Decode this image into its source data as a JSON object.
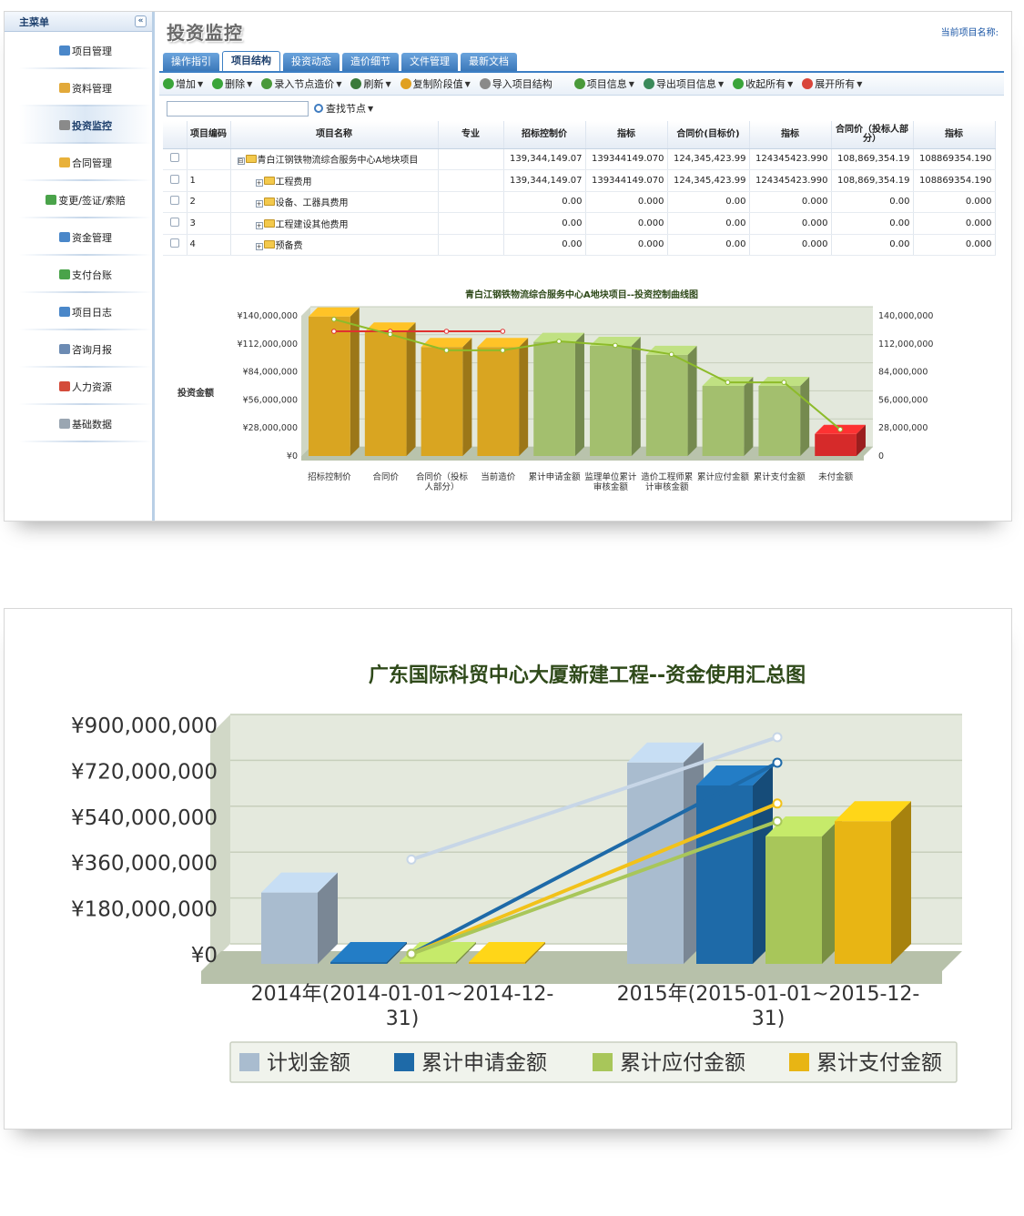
{
  "sidebar": {
    "header": "主菜单",
    "collapse": "«",
    "items": [
      {
        "label": "项目管理",
        "color": "#4a87c9"
      },
      {
        "label": "资料管理",
        "color": "#e2a93a"
      },
      {
        "label": "投资监控",
        "color": "#8a8a8a"
      },
      {
        "label": "合同管理",
        "color": "#e8b13a"
      },
      {
        "label": "变更/签证/索赔",
        "color": "#4aa34a"
      },
      {
        "label": "资金管理",
        "color": "#4a87c9"
      },
      {
        "label": "支付台账",
        "color": "#4aa34a"
      },
      {
        "label": "项目日志",
        "color": "#4a87c9"
      },
      {
        "label": "咨询月报",
        "color": "#6c8bb3"
      },
      {
        "label": "人力资源",
        "color": "#d44b3a"
      },
      {
        "label": "基础数据",
        "color": "#9aa6b2"
      }
    ]
  },
  "main": {
    "title": "投资监控",
    "project_name_label": "当前项目名称:",
    "tabs": [
      "操作指引",
      "项目结构",
      "投资动态",
      "造价细节",
      "文件管理",
      "最新文档"
    ],
    "active_tab": 1,
    "toolbar": [
      {
        "label": "增加",
        "icon": "add-icon",
        "color": "#3aa53a",
        "dropdown": true
      },
      {
        "label": "删除",
        "icon": "delete-icon",
        "color": "#3aa53a",
        "dropdown": true
      },
      {
        "label": "录入节点造价",
        "icon": "pencil-icon",
        "color": "#4a9a3a",
        "dropdown": true
      },
      {
        "label": "刷新",
        "icon": "refresh-icon",
        "color": "#3a7a3a",
        "dropdown": true
      },
      {
        "label": "复制阶段值",
        "icon": "copy-icon",
        "color": "#e0a020",
        "dropdown": true
      },
      {
        "label": "导入项目结构",
        "icon": "import-icon",
        "color": "#8a8a8a",
        "dropdown": false
      },
      {
        "label": "项目信息",
        "icon": "info-icon",
        "color": "#4a9a3a",
        "dropdown": true
      },
      {
        "label": "导出项目信息",
        "icon": "export-icon",
        "color": "#3a8a5a",
        "dropdown": true
      },
      {
        "label": "收起所有",
        "icon": "collapse-all-icon",
        "color": "#3aa53a",
        "dropdown": true
      },
      {
        "label": "展开所有",
        "icon": "expand-all-icon",
        "color": "#d9453a",
        "dropdown": true
      }
    ],
    "search": {
      "placeholder": "",
      "button_label": "查找节点"
    },
    "table": {
      "columns": [
        "项目编码",
        "项目名称",
        "专业",
        "招标控制价",
        "指标",
        "合同价(目标价)",
        "指标",
        "合同价（投标人部分）",
        "指标"
      ],
      "rows": [
        {
          "code": "",
          "name": "青白江钢铁物流综合服务中心A地块项目",
          "level": 0,
          "expander": "⊟",
          "major": "",
          "v1": "139,344,149.07",
          "i1": "139344149.070",
          "v2": "124,345,423.99",
          "i2": "124345423.990",
          "v3": "108,869,354.19",
          "i3": "108869354.190"
        },
        {
          "code": "1",
          "name": "工程费用",
          "level": 1,
          "expander": "+",
          "major": "",
          "v1": "139,344,149.07",
          "i1": "139344149.070",
          "v2": "124,345,423.99",
          "i2": "124345423.990",
          "v3": "108,869,354.19",
          "i3": "108869354.190"
        },
        {
          "code": "2",
          "name": "设备、工器具费用",
          "level": 1,
          "expander": "+",
          "major": "",
          "v1": "0.00",
          "i1": "0.000",
          "v2": "0.00",
          "i2": "0.000",
          "v3": "0.00",
          "i3": "0.000"
        },
        {
          "code": "3",
          "name": "工程建设其他费用",
          "level": 1,
          "expander": "+",
          "major": "",
          "v1": "0.00",
          "i1": "0.000",
          "v2": "0.00",
          "i2": "0.000",
          "v3": "0.00",
          "i3": "0.000"
        },
        {
          "code": "4",
          "name": "预备费",
          "level": 1,
          "expander": "+",
          "major": "",
          "v1": "0.00",
          "i1": "0.000",
          "v2": "0.00",
          "i2": "0.000",
          "v3": "0.00",
          "i3": "0.000"
        }
      ]
    }
  },
  "chart_data": [
    {
      "type": "bar",
      "title": "青白江钢铁物流综合服务中心A地块项目--投资控制曲线图",
      "ylabel": "投资金额",
      "xlabel": "",
      "ylim": [
        0,
        140000000
      ],
      "yticks_left": [
        "¥140,000,000",
        "¥112,000,000",
        "¥84,000,000",
        "¥56,000,000",
        "¥28,000,000",
        "¥0"
      ],
      "yticks_right": [
        "140,000,000",
        "112,000,000",
        "84,000,000",
        "56,000,000",
        "28,000,000",
        "0"
      ],
      "categories": [
        "招标控制价",
        "合同价",
        "合同价（投标人部分）",
        "当前造价",
        "累计申请金额",
        "监理单位累计审核金额",
        "造价工程师累计审核金额",
        "累计应付金额",
        "累计支付金额",
        "未付金额"
      ],
      "values": [
        139344149,
        124345424,
        108869354,
        108869354,
        114000000,
        110000000,
        101000000,
        70000000,
        70000000,
        22000000
      ],
      "bar_colors": [
        "#d9a521",
        "#d9a521",
        "#d9a521",
        "#d9a521",
        "#a3bf6e",
        "#a3bf6e",
        "#a3bf6e",
        "#a3bf6e",
        "#a3bf6e",
        "#d62a2a"
      ],
      "lines": [
        {
          "color": "#e03030",
          "values": [
            120000000,
            120000000,
            120000000,
            120000000,
            null,
            null,
            null,
            null,
            null,
            null
          ]
        },
        {
          "color": "#8dbb2a",
          "values": [
            132000000,
            117000000,
            101000000,
            101000000,
            110000000,
            106000000,
            97000000,
            69000000,
            69000000,
            22000000
          ]
        }
      ],
      "grid": true,
      "legend": "none"
    },
    {
      "type": "bar",
      "title": "广东国际科贸中心大厦新建工程--资金使用汇总图",
      "xlabel": "",
      "ylabel": "",
      "ylim": [
        0,
        900000000
      ],
      "yticks": [
        "¥900,000,000",
        "¥720,000,000",
        "¥540,000,000",
        "¥360,000,000",
        "¥180,000,000",
        "¥0"
      ],
      "categories": [
        "2014年(2014-01-01~2014-12-31)",
        "2015年(2015-01-01~2015-12-31)"
      ],
      "series": [
        {
          "name": "计划金额",
          "color": "#a9bccf",
          "values": [
            280000000,
            790000000
          ]
        },
        {
          "name": "累计申请金额",
          "color": "#1e6aa8",
          "values": [
            0,
            700000000
          ]
        },
        {
          "name": "累计应付金额",
          "color": "#a8c65a",
          "values": [
            0,
            500000000
          ]
        },
        {
          "name": "累计支付金额",
          "color": "#e8b514",
          "values": [
            0,
            560000000
          ]
        }
      ],
      "lines": [
        {
          "color": "#c7d6e7",
          "values": [
            370000000,
            850000000
          ]
        },
        {
          "color": "#1e6aa8",
          "values": [
            0,
            750000000
          ]
        },
        {
          "color": "#f2c21a",
          "values": [
            0,
            590000000
          ]
        },
        {
          "color": "#a8c65a",
          "values": [
            0,
            520000000
          ]
        }
      ],
      "grid": true,
      "legend": "bottom"
    }
  ]
}
